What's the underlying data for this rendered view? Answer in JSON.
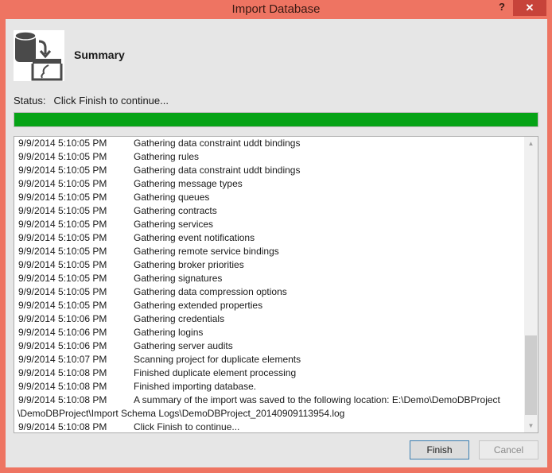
{
  "window": {
    "title": "Import Database",
    "help": "?",
    "close": "✕"
  },
  "header": {
    "title": "Summary",
    "icon": "database-import-icon"
  },
  "status": {
    "label": "Status:",
    "text": "Click Finish to continue...",
    "progress_percent": 100
  },
  "log": [
    {
      "time": "9/9/2014 5:10:05 PM",
      "msg": "Gathering data constraint uddt bindings"
    },
    {
      "time": "9/9/2014 5:10:05 PM",
      "msg": "Gathering rules"
    },
    {
      "time": "9/9/2014 5:10:05 PM",
      "msg": "Gathering data constraint uddt bindings"
    },
    {
      "time": "9/9/2014 5:10:05 PM",
      "msg": "Gathering message types"
    },
    {
      "time": "9/9/2014 5:10:05 PM",
      "msg": "Gathering queues"
    },
    {
      "time": "9/9/2014 5:10:05 PM",
      "msg": "Gathering contracts"
    },
    {
      "time": "9/9/2014 5:10:05 PM",
      "msg": "Gathering services"
    },
    {
      "time": "9/9/2014 5:10:05 PM",
      "msg": "Gathering event notifications"
    },
    {
      "time": "9/9/2014 5:10:05 PM",
      "msg": "Gathering remote service bindings"
    },
    {
      "time": "9/9/2014 5:10:05 PM",
      "msg": "Gathering broker priorities"
    },
    {
      "time": "9/9/2014 5:10:05 PM",
      "msg": "Gathering signatures"
    },
    {
      "time": "9/9/2014 5:10:05 PM",
      "msg": "Gathering data compression options"
    },
    {
      "time": "9/9/2014 5:10:05 PM",
      "msg": "Gathering extended properties"
    },
    {
      "time": "9/9/2014 5:10:06 PM",
      "msg": "Gathering credentials"
    },
    {
      "time": "9/9/2014 5:10:06 PM",
      "msg": "Gathering logins"
    },
    {
      "time": "9/9/2014 5:10:06 PM",
      "msg": "Gathering server audits"
    },
    {
      "time": "9/9/2014 5:10:07 PM",
      "msg": "Scanning project for duplicate elements"
    },
    {
      "time": "9/9/2014 5:10:08 PM",
      "msg": "Finished duplicate element processing"
    },
    {
      "time": "9/9/2014 5:10:08 PM",
      "msg": "Finished importing database."
    },
    {
      "time": "9/9/2014 5:10:08 PM",
      "msg": "A summary of the import was saved to the following location: E:\\Demo\\DemoDBProject",
      "cont": "\\DemoDBProject\\Import Schema Logs\\DemoDBProject_20140909113954.log"
    },
    {
      "time": "9/9/2014 5:10:08 PM",
      "msg": "Click Finish to continue..."
    }
  ],
  "buttons": {
    "finish": "Finish",
    "cancel": "Cancel"
  }
}
